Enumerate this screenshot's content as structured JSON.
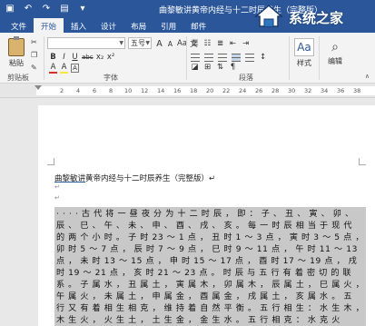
{
  "titlebar": {
    "doc_title": "曲黎敏讲黄帝内经与十二时辰养生（完整版）",
    "qat_icons": [
      "save-icon",
      "undo-icon",
      "redo-icon",
      "print-icon",
      "customize-icon"
    ]
  },
  "tabs": [
    {
      "label": "文件"
    },
    {
      "label": "开始"
    },
    {
      "label": "插入"
    },
    {
      "label": "设计"
    },
    {
      "label": "布局"
    },
    {
      "label": "引用"
    },
    {
      "label": "邮件"
    }
  ],
  "ribbon": {
    "paste_label": "粘贴",
    "clipboard_group": "剪贴板",
    "font_name": "",
    "font_size": "五号",
    "grow_font": "A",
    "shrink_font": "A",
    "aa_label": "Aa",
    "wen_label": "文",
    "bold": "B",
    "italic": "I",
    "underline": "U",
    "strike": "abc",
    "subscript": "x₂",
    "superscript": "x²",
    "font_color": "A",
    "highlight": "A",
    "char_border": "A",
    "font_group": "字体",
    "paragraph_group": "段落",
    "styles_label": "样式",
    "styles_icon": "Aa",
    "editing_label": "编辑",
    "accent_color": "#2b579a"
  },
  "ruler": {
    "numbers": [
      "2",
      "4",
      "6",
      "8",
      "10",
      "12",
      "14",
      "16",
      "18",
      "20",
      "22",
      "24",
      "26",
      "28",
      "30",
      "32",
      "34",
      "36",
      "38"
    ]
  },
  "document": {
    "title_underlined": "曲黎敏讲",
    "title_rest": "黄帝内经与十二时辰养生（完整版）↵",
    "empty_line_1": "↵",
    "empty_line_2": "↵",
    "lines": [
      "· · · · 古 代 将 一 昼 夜 分 为 十 二 时 辰 ， 即 ： 子 、 丑 、 寅 、 卯 、",
      "辰 、 巳 、 午 、 未 、 申 、 酉 、 戌 、 亥 。 每 一 时 辰 相 当 于 现 代",
      "的 两 个 小 时 。 子 时 23 ～ 1 点 ， 丑 时 1 ～ 3 点 ， 寅 时 3 ～ 5 点 ，",
      "卯 时 5 ～ 7 点 ， 辰 时 7 ～ 9 点 ， 巳 时 9 ～ 11 点 ， 午 时 11 ～ 13",
      "点 ， 未 时 13 ～ 15 点 ， 申 时 15 ～ 17 点 ， 酉 时 17 ～ 19 点 ， 戌",
      "时 19 ～ 21 点 ， 亥 时 21 ～ 23 点 。 时 辰 与 五 行 有 着 密 切 的 联",
      "系 。 子 属 水 ， 丑 属 土 ， 寅 属 木 ， 卯 属 木 ， 辰 属 土 ， 巳 属 火 ，",
      "午 属 火 ， 未 属 土 ， 申 属 金 ， 酉 属 金 ， 戌 属 土 ， 亥 属 水 。 五",
      "行 又 有 着 相 生 相 克 ， 维 持 着 自 然 平 衡 。 五 行 相 生 ： 水 生 木 ，",
      "木 生 火 ， 火 生 土 ， 土 生 金 ， 金 生 水 。 五 行 相 克 ： 水 克 火"
    ]
  },
  "watermark": {
    "text": "系统之家"
  }
}
